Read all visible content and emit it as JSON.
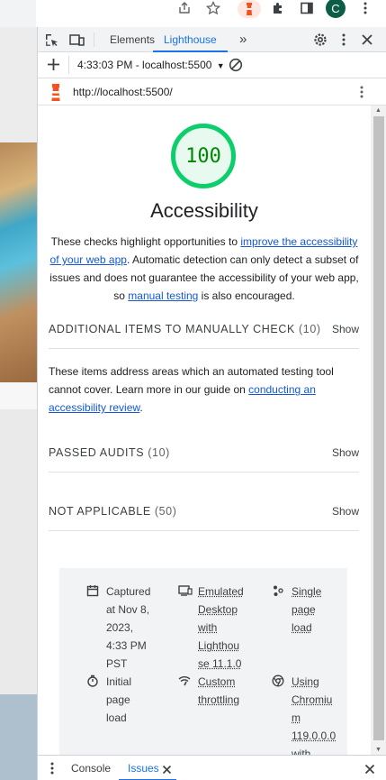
{
  "browser": {
    "icons": [
      "share-icon",
      "star-icon",
      "lighthouse-extension-icon",
      "extensions-puzzle-icon",
      "side-panel-icon",
      "profile-avatar",
      "browser-menu-icon"
    ],
    "avatar_letter": "C"
  },
  "devtools": {
    "tabs": [
      {
        "label": "Elements",
        "active": false
      },
      {
        "label": "Lighthouse",
        "active": true
      }
    ],
    "more_tabs_glyph": "»"
  },
  "lighthouse_toolbar": {
    "report_selector": "4:33:03 PM - localhost:5500"
  },
  "url_bar": {
    "url": "http://localhost:5500/"
  },
  "report": {
    "score": "100",
    "category_title": "Accessibility",
    "description": {
      "part1": "These checks highlight opportunities to ",
      "link1": "improve the accessibility of your web app",
      "part2": ". Automatic detection can only detect a subset of issues and does not guarantee the accessibility of your web app, so ",
      "link2": "manual testing",
      "part3": " is also encouraged."
    },
    "groups": [
      {
        "title": "ADDITIONAL ITEMS TO MANUALLY CHECK",
        "count": "(10)",
        "action": "Show"
      },
      {
        "title": "PASSED AUDITS",
        "count": "(10)",
        "action": "Show"
      },
      {
        "title": "NOT APPLICABLE",
        "count": "(50)",
        "action": "Show"
      }
    ],
    "manual_desc": {
      "part1": "These items address areas which an automated testing tool cannot cover. Learn more in our guide on ",
      "link": "conducting an accessibility review",
      "part2": "."
    },
    "footer": [
      {
        "icon": "calendar-icon",
        "lines": [
          "Captured",
          "at Nov 8,",
          "2023,",
          "4:33 PM",
          "PST"
        ]
      },
      {
        "icon": "desktop-icon",
        "lines": [
          "Emulated",
          "Desktop",
          "with",
          "Lighthou",
          "se 11.1.0"
        ]
      },
      {
        "icon": "single-page-icon",
        "lines": [
          "Single",
          "page",
          "load"
        ]
      },
      {
        "icon": "timer-icon",
        "lines": [
          "Initial",
          "page",
          "load"
        ]
      },
      {
        "icon": "wifi-throttle-icon",
        "lines": [
          "Custom",
          "throttling"
        ]
      },
      {
        "icon": "chromium-icon",
        "lines": [
          "Using",
          "Chromiu",
          "m",
          "119.0.0.0",
          "with"
        ]
      }
    ]
  },
  "drawer": {
    "tabs": [
      {
        "label": "Console",
        "active": false
      },
      {
        "label": "Issues",
        "active": true
      }
    ]
  },
  "colors": {
    "accent": "#1a73e8",
    "score_green": "#0cce6b",
    "link": "#1558d6"
  }
}
